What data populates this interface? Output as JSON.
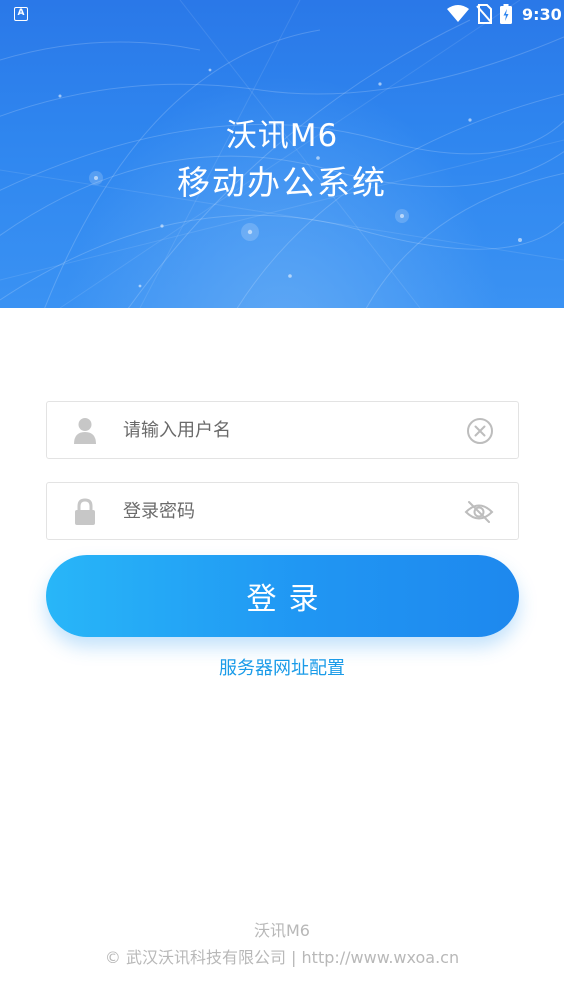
{
  "status_bar": {
    "app_badge": "A",
    "time": "9:30",
    "icons": [
      "app-notification-icon",
      "wifi-icon",
      "no-sim-icon",
      "battery-icon"
    ]
  },
  "header": {
    "title_line1": "沃讯M6",
    "title_line2": "移动办公系统"
  },
  "form": {
    "username": {
      "placeholder": "请输入用户名",
      "value": "",
      "lead_icon": "user-icon",
      "trail_icon": "clear-circle-icon"
    },
    "password": {
      "placeholder": "登录密码",
      "value": "",
      "lead_icon": "lock-icon",
      "trail_icon": "eye-hidden-icon"
    },
    "login_label": "登录",
    "server_config_label": "服务器网址配置"
  },
  "footer": {
    "product": "沃讯M6",
    "copyright": "© 武汉沃讯科技有限公司 | http://www.wxoa.cn"
  },
  "colors": {
    "banner_top": "#2a78e8",
    "banner_bottom": "#3a92f3",
    "button_start": "#28b6f8",
    "button_end": "#1e88ee",
    "link": "#1a9be8",
    "footer_text": "#b8b8b8",
    "field_border": "#e3e3e3",
    "icon_gray": "#c7c7c7"
  }
}
